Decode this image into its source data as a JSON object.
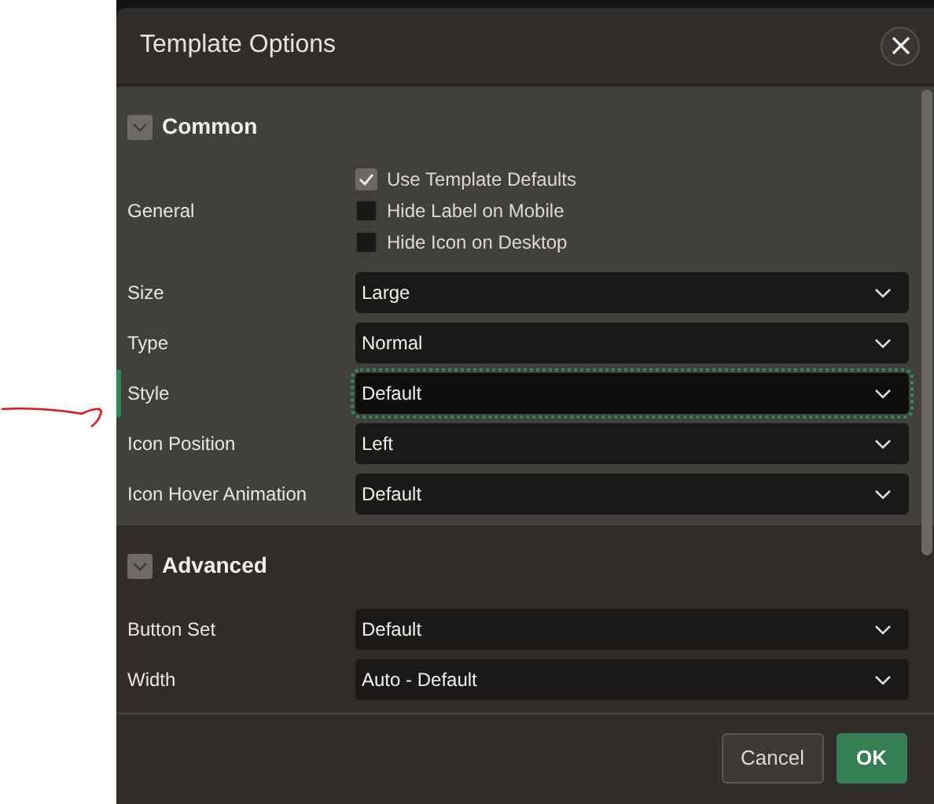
{
  "dialog": {
    "title": "Template Options"
  },
  "sections": [
    {
      "title": "Common",
      "expanded": true,
      "general": {
        "label": "General",
        "options": [
          {
            "label": "Use Template Defaults",
            "checked": true
          },
          {
            "label": "Hide Label on Mobile",
            "checked": false
          },
          {
            "label": "Hide Icon on Desktop",
            "checked": false
          }
        ]
      },
      "fields": [
        {
          "label": "Size",
          "value": "Large",
          "focused": false
        },
        {
          "label": "Type",
          "value": "Normal",
          "focused": false
        },
        {
          "label": "Style",
          "value": "Default",
          "focused": true
        },
        {
          "label": "Icon Position",
          "value": "Left",
          "focused": false
        },
        {
          "label": "Icon Hover Animation",
          "value": "Default",
          "focused": false
        }
      ]
    },
    {
      "title": "Advanced",
      "expanded": true,
      "fields": [
        {
          "label": "Button Set",
          "value": "Default",
          "focused": false
        },
        {
          "label": "Width",
          "value": "Auto - Default",
          "focused": false
        }
      ]
    }
  ],
  "buttons": [
    {
      "label": "Cancel",
      "kind": "secondary"
    },
    {
      "label": "OK",
      "kind": "primary"
    }
  ]
}
